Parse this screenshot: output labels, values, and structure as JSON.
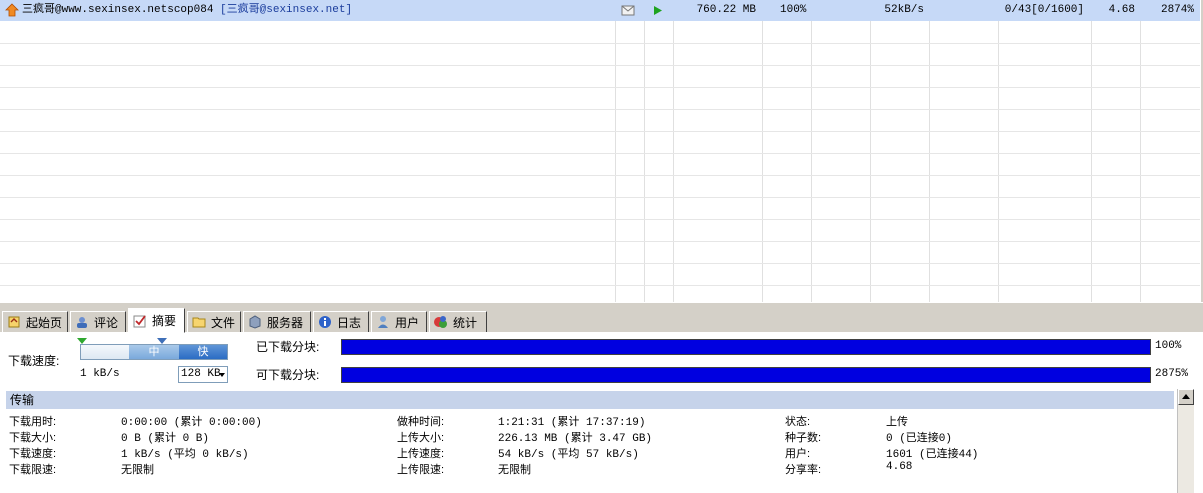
{
  "task": {
    "nick": "三疯哥",
    "name": "@www.sexinsex.netscop084",
    "bracket": "[三疯哥@sexinsex.net]",
    "size": "760.22 MB",
    "progress": "100%",
    "speed": "52kB/s",
    "peers": "0/43[0/1600]",
    "ratio": "4.68",
    "completion": "2874%"
  },
  "tabs": [
    {
      "label": "起始页",
      "icon": "home-icon"
    },
    {
      "label": "评论",
      "icon": "comment-icon"
    },
    {
      "label": "摘要",
      "icon": "check-icon"
    },
    {
      "label": "文件",
      "icon": "folder-icon"
    },
    {
      "label": "服务器",
      "icon": "server-icon"
    },
    {
      "label": "日志",
      "icon": "info-icon"
    },
    {
      "label": "用户",
      "icon": "user-icon"
    },
    {
      "label": "统计",
      "icon": "stats-icon"
    }
  ],
  "active_tab": 2,
  "summary": {
    "download_speed_label": "下载速度:",
    "slider_mid": "中",
    "slider_fast": "快",
    "speed_value": "1 kB/s",
    "limit_value": "128 KB",
    "downloaded_pieces_label": "已下载分块:",
    "downloaded_pieces_pct": "100%",
    "downloaded_pieces_fill": 100,
    "available_pieces_label": "可下载分块:",
    "available_pieces_pct": "2875%",
    "available_pieces_fill": 100
  },
  "transfer": {
    "section_title": "传输",
    "col1": [
      {
        "k": "下载用时:",
        "v": "0:00:00 (累计 0:00:00)"
      },
      {
        "k": "下载大小:",
        "v": "0 B (累计 0 B)"
      },
      {
        "k": "下载速度:",
        "v": "1 kB/s (平均 0 kB/s)"
      },
      {
        "k": "下载限速:",
        "v": "无限制"
      }
    ],
    "col2": [
      {
        "k": "做种时间:",
        "v": "1:21:31 (累计 17:37:19)"
      },
      {
        "k": "上传大小:",
        "v": "226.13 MB (累计 3.47 GB)"
      },
      {
        "k": "上传速度:",
        "v": "54 kB/s (平均 57 kB/s)"
      },
      {
        "k": "上传限速:",
        "v": "无限制"
      }
    ],
    "col3": [
      {
        "k": "状态:",
        "v": "上传"
      },
      {
        "k": "种子数:",
        "v": "0 (已连接0)"
      },
      {
        "k": "用户:",
        "v": "1601 (已连接44)"
      },
      {
        "k": "分享率:",
        "v": "4.68"
      }
    ]
  },
  "colors": {
    "selection": "#c6d9f7",
    "bar_fill": "#0000e0",
    "section_header": "#c6d3ea"
  }
}
